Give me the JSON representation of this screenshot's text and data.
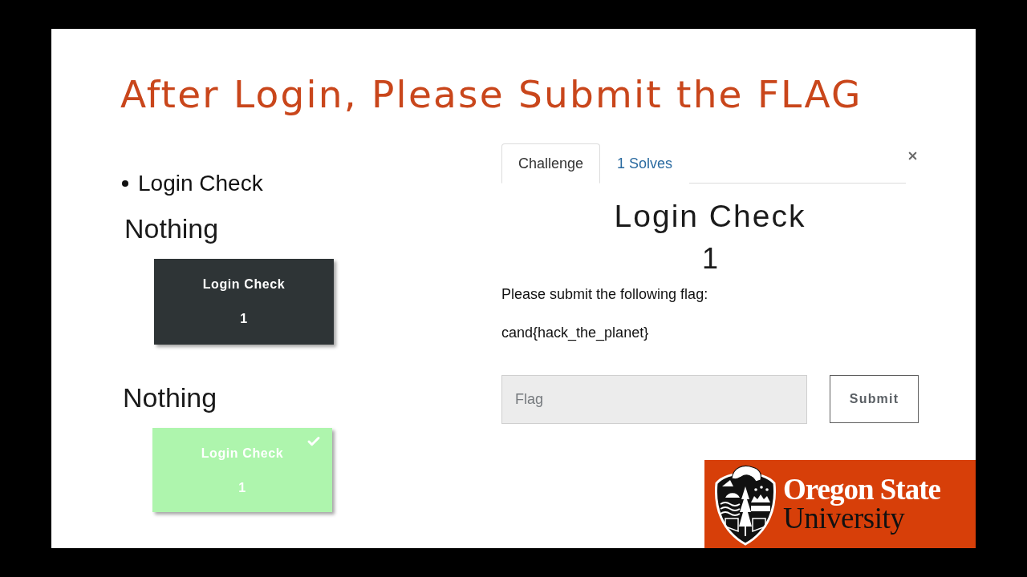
{
  "slide": {
    "title": "After Login, Please Submit the FLAG",
    "bullet": "Login Check",
    "examples": [
      {
        "caption": "Nothing",
        "card": {
          "name": "Login Check",
          "value": "1",
          "solved": false
        }
      },
      {
        "caption": "Nothing",
        "card": {
          "name": "Login Check",
          "value": "1",
          "solved": true
        }
      }
    ]
  },
  "challenge_modal": {
    "tabs": [
      {
        "label": "Challenge",
        "selected": true
      },
      {
        "label": "1 Solves",
        "selected": false
      }
    ],
    "name": "Login Check",
    "value": "1",
    "description": "Please submit the following flag:",
    "flag": "cand{hack_the_planet}",
    "flag_input": {
      "placeholder": "Flag"
    },
    "submit_button": "Submit"
  },
  "logo": {
    "line_1": "Oregon State",
    "line_2": "University"
  }
}
